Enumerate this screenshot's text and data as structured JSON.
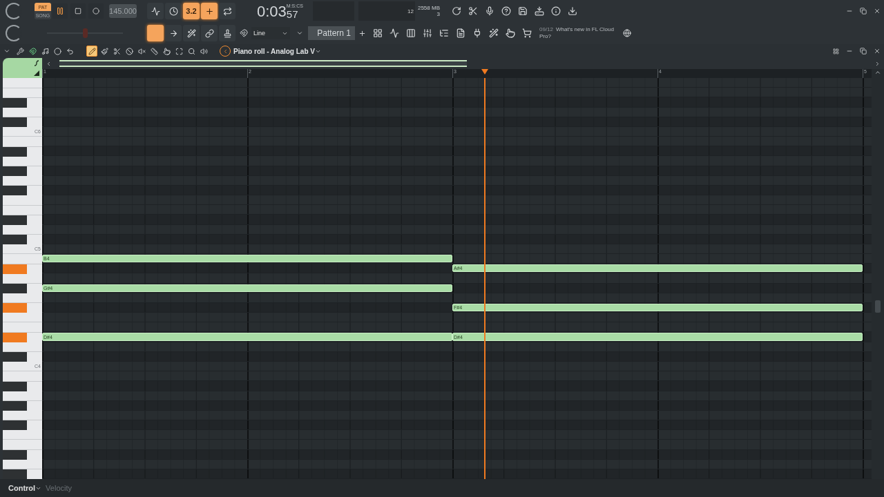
{
  "transport": {
    "mode": [
      {
        "label": "PAT",
        "selected": true
      },
      {
        "label": "SONG",
        "selected": false
      }
    ],
    "playing": true,
    "recording": false,
    "tempo": "145.000"
  },
  "toggles": [
    {
      "kind": "metronome",
      "on": false
    },
    {
      "kind": "wait",
      "on": false
    },
    {
      "kind": "countdown",
      "label": "3.2",
      "on": true
    },
    {
      "kind": "blend",
      "on": true
    },
    {
      "kind": "loop",
      "on": false
    }
  ],
  "clock": {
    "time": "0:03",
    "centis": "57",
    "unit": "M:S:CS"
  },
  "monitor": {
    "polyphony": "12",
    "memory": "2558 MB",
    "voices": "3"
  },
  "master_pitch": {
    "level": 0.5
  },
  "view_buttons": [
    {
      "on": true
    },
    {
      "on": false
    },
    {
      "on": false
    },
    {
      "on": false
    },
    {
      "on": false
    }
  ],
  "snap": "Line",
  "pattern": "Pattern 1",
  "news": {
    "date": "09/12",
    "text": "What's new in FL Cloud Pro?"
  },
  "piano_roll": {
    "title": "Piano roll - Analog Lab V",
    "magnet_on": true,
    "tools": [
      {
        "selected": true
      },
      {
        "selected": false
      },
      {
        "selected": false
      },
      {
        "selected": false
      },
      {
        "selected": false
      },
      {
        "selected": false
      },
      {
        "selected": false
      },
      {
        "selected": false
      },
      {
        "selected": false
      },
      {
        "selected": false
      }
    ],
    "ruler": [
      "1",
      "2",
      "3",
      "4",
      "5"
    ],
    "playhead": {
      "level": 0.534
    },
    "rows": [
      {
        "kind": "white",
        "pressed": false
      },
      {
        "kind": "white",
        "pressed": false
      },
      {
        "kind": "black",
        "pressed": false
      },
      {
        "kind": "white",
        "pressed": false
      },
      {
        "kind": "black",
        "pressed": false
      },
      {
        "kind": "white",
        "pressed": false,
        "label": "C6"
      },
      {
        "kind": "white",
        "pressed": false
      },
      {
        "kind": "black",
        "pressed": false
      },
      {
        "kind": "white",
        "pressed": false
      },
      {
        "kind": "black",
        "pressed": false
      },
      {
        "kind": "white",
        "pressed": false
      },
      {
        "kind": "black",
        "pressed": false
      },
      {
        "kind": "white",
        "pressed": false
      },
      {
        "kind": "white",
        "pressed": false
      },
      {
        "kind": "black",
        "pressed": false
      },
      {
        "kind": "white",
        "pressed": false
      },
      {
        "kind": "black",
        "pressed": false
      },
      {
        "kind": "white",
        "pressed": false,
        "label": "C5"
      },
      {
        "kind": "white",
        "pressed": false,
        "notes": [
          {
            "label": "B4",
            "kind": "first"
          }
        ]
      },
      {
        "kind": "black",
        "pressed": true,
        "notes": [
          {
            "label": "A#4",
            "kind": "second"
          }
        ]
      },
      {
        "kind": "white",
        "pressed": false
      },
      {
        "kind": "black",
        "pressed": false,
        "notes": [
          {
            "label": "G#4",
            "kind": "first"
          }
        ]
      },
      {
        "kind": "white",
        "pressed": false
      },
      {
        "kind": "black",
        "pressed": true,
        "notes": [
          {
            "label": "F#4",
            "kind": "second"
          }
        ]
      },
      {
        "kind": "white",
        "pressed": false
      },
      {
        "kind": "white",
        "pressed": false
      },
      {
        "kind": "black",
        "pressed": true,
        "notes": [
          {
            "label": "D#4",
            "kind": "first"
          },
          {
            "label": "D#4",
            "kind": "second"
          }
        ]
      },
      {
        "kind": "white",
        "pressed": false
      },
      {
        "kind": "black",
        "pressed": false
      },
      {
        "kind": "white",
        "pressed": false,
        "label": "C4"
      },
      {
        "kind": "white",
        "pressed": false
      },
      {
        "kind": "black",
        "pressed": false
      },
      {
        "kind": "white",
        "pressed": false
      },
      {
        "kind": "black",
        "pressed": false
      },
      {
        "kind": "white",
        "pressed": false
      },
      {
        "kind": "black",
        "pressed": false
      },
      {
        "kind": "white",
        "pressed": false
      },
      {
        "kind": "white",
        "pressed": false
      },
      {
        "kind": "black",
        "pressed": false
      },
      {
        "kind": "white",
        "pressed": false
      },
      {
        "kind": "black",
        "pressed": false
      }
    ],
    "event_editor": {
      "control": "Control",
      "target": "Velocity"
    }
  }
}
